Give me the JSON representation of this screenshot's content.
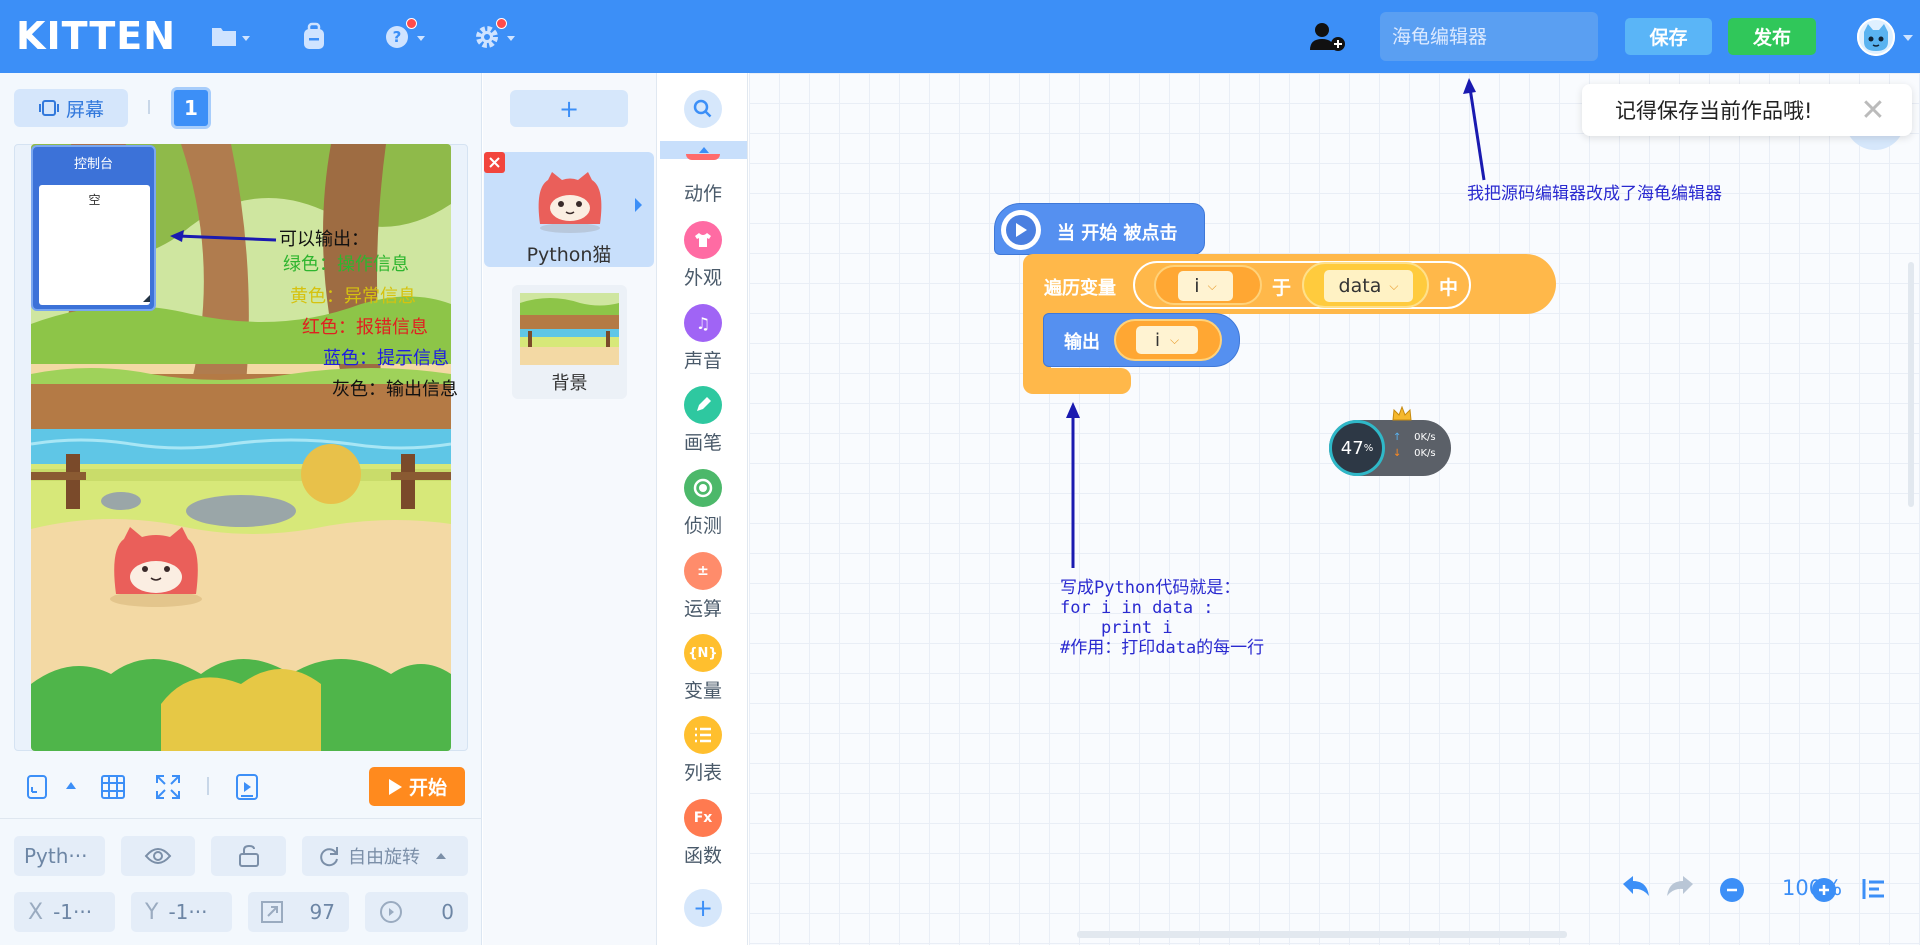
{
  "header": {
    "logo": "KITTEN",
    "title_placeholder": "海龟编辑器",
    "save_label": "保存",
    "publish_label": "发布"
  },
  "stage": {
    "screen_label": "屏幕",
    "screen_number": "1",
    "console_title": "控制台",
    "console_content": "空",
    "legend": {
      "title": "可以输出：",
      "green": "绿色：操作信息",
      "yellow": "黄色：异常信息",
      "red": "红色：报错信息",
      "blue": "蓝色：提示信息",
      "gray": "灰色：输出信息"
    },
    "start_label": "开始"
  },
  "sprite_props": {
    "name": "Pyth···",
    "rotation_label": "自由旋转",
    "x_label": "X",
    "x_value": "-1···",
    "y_label": "Y",
    "y_value": "-1···",
    "size_value": "97",
    "direction_value": "0"
  },
  "sprites": {
    "add_label": "+",
    "items": [
      {
        "name": "Python猫"
      },
      {
        "name": "背景"
      }
    ]
  },
  "categories": [
    {
      "label": "动作",
      "color": "#ff6b6b"
    },
    {
      "label": "外观",
      "color": "#ff6ba3"
    },
    {
      "label": "声音",
      "color": "#a064f5"
    },
    {
      "label": "画笔",
      "color": "#2ec8a0"
    },
    {
      "label": "侦测",
      "color": "#4cb86a"
    },
    {
      "label": "运算",
      "color": "#ff8c6b"
    },
    {
      "label": "变量",
      "color": "#ffbf2e"
    },
    {
      "label": "列表",
      "color": "#ffbf2e"
    },
    {
      "label": "函数",
      "color": "#ff7a50"
    }
  ],
  "blocks": {
    "hat": "当 开始 被点击",
    "loop_label": "遍历变量",
    "loop_var": "i",
    "loop_in": "于",
    "loop_list": "data",
    "loop_end": "中",
    "print_label": "输出",
    "print_arg": "i"
  },
  "network": {
    "percent": "47",
    "percent_unit": "%",
    "up": "0K/s",
    "down": "0K/s"
  },
  "annotations": {
    "editor_note": "我把源码编辑器改成了海龟编辑器",
    "code_note": "写成Python代码就是：\nfor i in data :\n    print i\n#作用：打印data的每一行"
  },
  "toast": {
    "message": "记得保存当前作品哦!"
  },
  "zoom": {
    "level": "100%"
  }
}
